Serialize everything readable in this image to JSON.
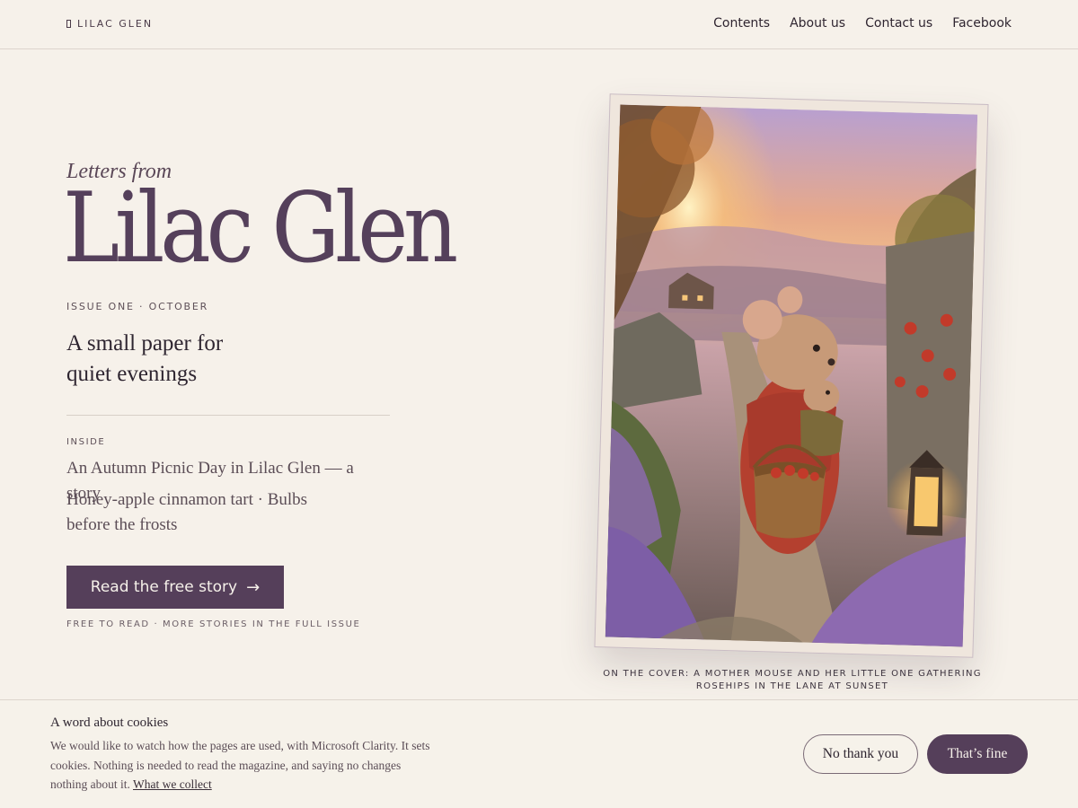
{
  "header": {
    "brand": "LILAC GLEN",
    "brand_icon": "square-mark-icon",
    "nav": [
      "Contents",
      "About us",
      "Contact us",
      "Facebook"
    ]
  },
  "hero": {
    "kicker": "Letters from",
    "title": "Lilac Glen",
    "issue": "ISSUE ONE · OCTOBER",
    "tagline_line1": "A small paper for",
    "tagline_line2": "quiet evenings",
    "inside_label": "INSIDE",
    "inside_items": [
      "An Autumn Picnic Day in Lilac Glen — a story",
      "Honey-apple cinnamon tart · Bulbs before the frosts"
    ],
    "cta_label": "Read the free story",
    "cta_icon": "arrow-right-icon",
    "free_note": "FREE TO READ · MORE STORIES IN THE FULL ISSUE"
  },
  "cover": {
    "image_description": "Illustrated magazine cover: mouse in red shawl with basket by a lantern on a sunset lane",
    "caption": "ON THE COVER: A MOTHER MOUSE AND HER LITTLE ONE GATHERING ROSEHIPS IN THE LANE AT SUNSET"
  },
  "cookies": {
    "title": "A word about cookies",
    "text": "We would like to watch how the pages are used, with Microsoft Clarity. It sets cookies. Nothing is needed to read the magazine, and saying no changes nothing about it.",
    "link": "What we collect",
    "decline": "No thank you",
    "accept": "That’s fine"
  },
  "colors": {
    "background": "#f6f1ea",
    "accent": "#553f5a",
    "title": "#55405b"
  }
}
